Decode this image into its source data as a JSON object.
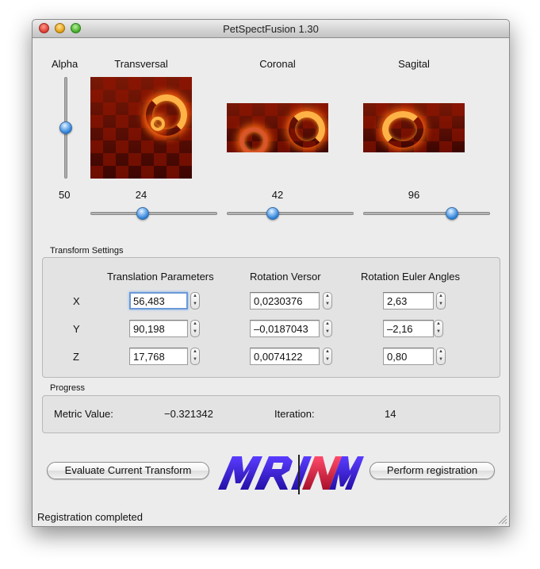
{
  "window": {
    "title": "PetSpectFusion 1.30"
  },
  "viewer": {
    "alpha": {
      "label": "Alpha",
      "value": "50",
      "level": 0.5
    },
    "panels": [
      {
        "name": "Transversal",
        "value": "24",
        "level": 0.4
      },
      {
        "name": "Coronal",
        "value": "42",
        "level": 0.35
      },
      {
        "name": "Sagital",
        "value": "96",
        "level": 0.72
      }
    ]
  },
  "transform": {
    "group_title": "Transform Settings",
    "headers": [
      "Translation Parameters",
      "Rotation Versor",
      "Rotation Euler Angles"
    ],
    "rows": [
      {
        "axis": "X",
        "translation": "56,483",
        "versor": "0,0230376",
        "euler": "2,63"
      },
      {
        "axis": "Y",
        "translation": "90,198",
        "versor": "–0,0187043",
        "euler": "–2,16"
      },
      {
        "axis": "Z",
        "translation": "17,768",
        "versor": "0,0074122",
        "euler": "0,80"
      }
    ]
  },
  "progress": {
    "group_title": "Progress",
    "metric_label": "Metric Value:",
    "metric_value": "−0.321342",
    "iteration_label": "Iteration:",
    "iteration_value": "14"
  },
  "buttons": {
    "evaluate": "Evaluate Current Transform",
    "register": "Perform registration"
  },
  "logo": {
    "text": "MRINM",
    "icon": "mri-nm-logo"
  },
  "status": "Registration completed",
  "colors": {
    "knob": "#2b7fd6",
    "focus": "#6a9ad8",
    "logo_blue": "#3a1fd0",
    "logo_red": "#d21a3a"
  }
}
